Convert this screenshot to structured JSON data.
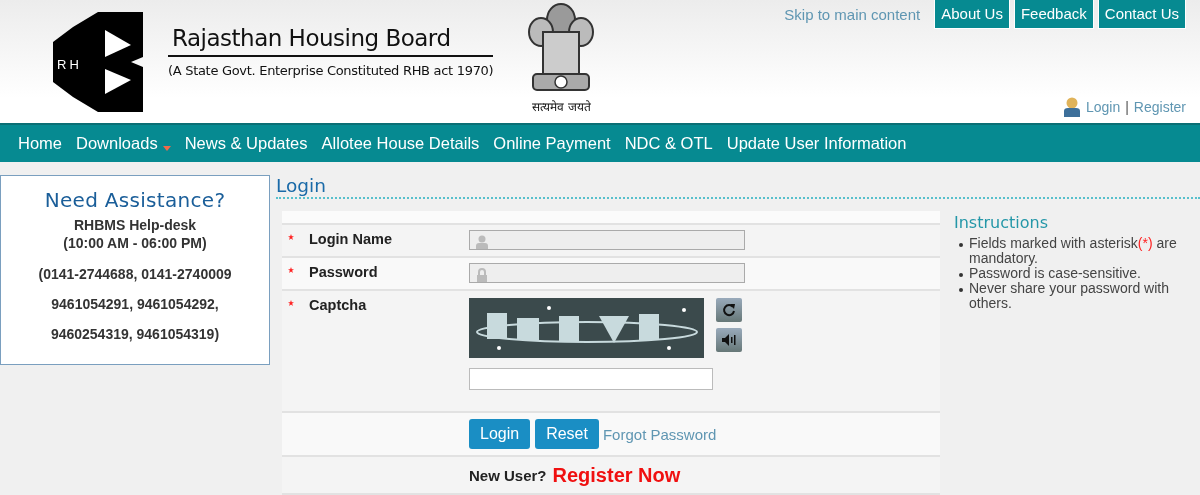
{
  "header": {
    "logo_text": "RH",
    "title": "Rajasthan Housing Board",
    "subtitle": "(A State Govt. Enterprise Constituted RHB act 1970)",
    "emblem_motto": "सत्यमेव जयते",
    "skip_link": "Skip to main content",
    "top_buttons": [
      "About Us",
      "Feedback",
      "Contact Us"
    ],
    "account_links": [
      "Login",
      "Register"
    ],
    "account_separator": "|"
  },
  "nav": {
    "items": [
      {
        "label": "Home",
        "dropdown": false
      },
      {
        "label": "Downloads",
        "dropdown": true
      },
      {
        "label": "News & Updates",
        "dropdown": false
      },
      {
        "label": "Allotee House Details",
        "dropdown": false
      },
      {
        "label": "Online Payment",
        "dropdown": false
      },
      {
        "label": "NDC & OTL",
        "dropdown": false
      },
      {
        "label": "Update User Information",
        "dropdown": false
      }
    ]
  },
  "assistance": {
    "title": "Need Assistance?",
    "lines": [
      "RHBMS Help-desk",
      "(10:00 AM - 06:00 PM)",
      "(0141-2744688, 0141-2740009",
      "9461054291, 9461054292,",
      "9460254319, 9461054319)"
    ]
  },
  "login": {
    "title": "Login",
    "fields": [
      {
        "kind": "text",
        "label": "Login Name",
        "required": true
      },
      {
        "kind": "password",
        "label": "Password",
        "required": true
      },
      {
        "kind": "captcha",
        "label": "Captcha",
        "required": true
      }
    ],
    "buttons": [
      "Login",
      "Reset"
    ],
    "forgot_link": "Forgot Password",
    "new_user_text": "New User?",
    "register_link": "Register Now"
  },
  "instructions": {
    "title": "Instructions",
    "items": [
      {
        "text": "Fields marked with asterisk",
        "mark": "(*)",
        "text_after": " are mandatory."
      },
      {
        "text": "Password is case-sensitive."
      },
      {
        "text": "Never share your password with others."
      }
    ]
  }
}
